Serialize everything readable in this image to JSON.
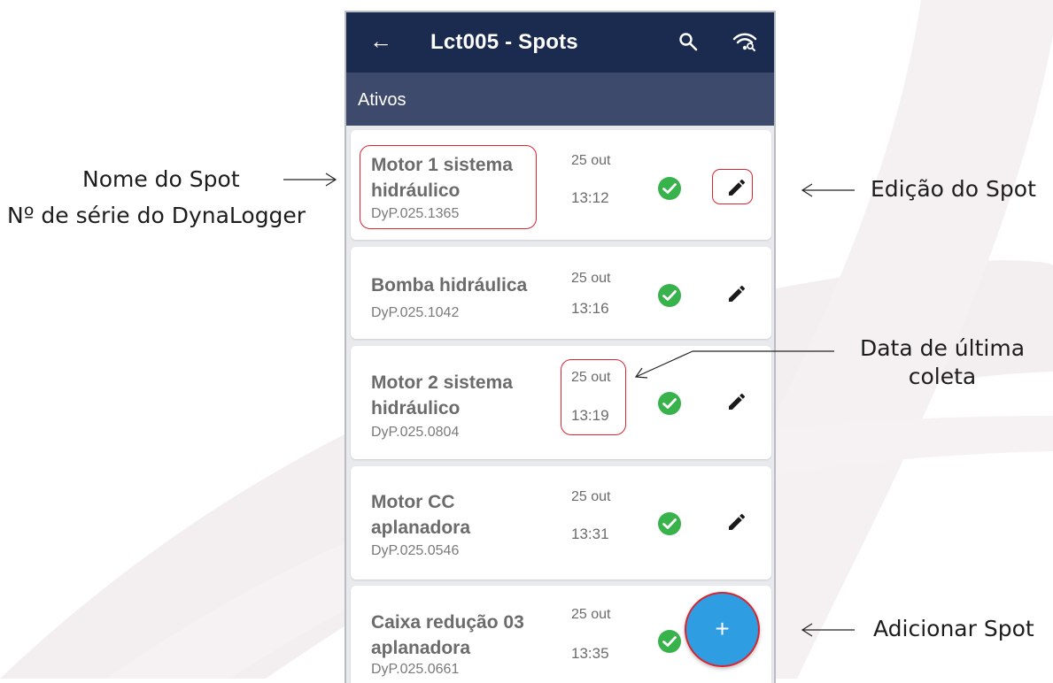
{
  "app_bar": {
    "title": "Lct005 - Spots",
    "back_icon": "arrow-back-icon",
    "search_icon": "search-icon",
    "wifi_icon": "wifi-search-icon"
  },
  "section": {
    "label": "Ativos"
  },
  "spots": [
    {
      "name_line1": "Motor 1 sistema",
      "name_line2": "hidráulico",
      "serial": "DyP.025.1365",
      "date": "25 out",
      "time": "13:12"
    },
    {
      "name_line1": "Bomba hidráulica",
      "name_line2": "",
      "serial": "DyP.025.1042",
      "date": "25 out",
      "time": "13:16"
    },
    {
      "name_line1": "Motor 2 sistema",
      "name_line2": "hidráulico",
      "serial": "DyP.025.0804",
      "date": "25 out",
      "time": "13:19"
    },
    {
      "name_line1": "Motor CC",
      "name_line2": "aplanadora",
      "serial": "DyP.025.0546",
      "date": "25 out",
      "time": "13:31"
    },
    {
      "name_line1": "Caixa redução 03",
      "name_line2": "aplanadora",
      "serial": "DyP.025.0661",
      "date": "25 out",
      "time": "13:35"
    }
  ],
  "fab": {
    "label": "+"
  },
  "annotations": {
    "spot_name": "Nome do Spot",
    "serial_number": "Nº de série do DynaLogger",
    "edit": "Edição do Spot",
    "last_date_line1": "Data de última",
    "last_date_line2": "coleta",
    "add": "Adicionar Spot"
  },
  "colors": {
    "app_bar": "#1b2a4f",
    "section_bar": "#3d4a6b",
    "status_ok": "#38b24a",
    "fab": "#2f9de2",
    "highlight": "#d9252f"
  }
}
